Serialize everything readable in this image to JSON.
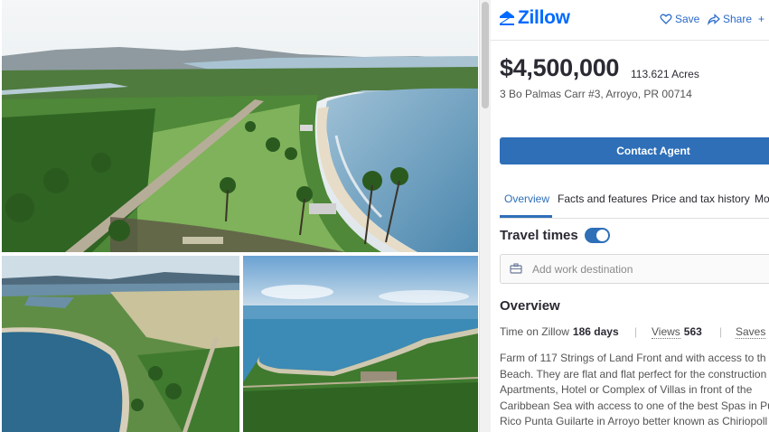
{
  "gallery": {
    "main_photo": "aerial-coastline-palm-estate",
    "bottom_left_photo": "aerial-bay-and-town",
    "bottom_right_photo": "aerial-ocean-shoreline"
  },
  "header": {
    "logo_text": "Zillow",
    "logo_icon": "zillow-z-house-icon",
    "save_label": "Save",
    "share_label": "Share",
    "more_glyph": "+"
  },
  "listing": {
    "price": "$4,500,000",
    "acres": "113.621 Acres",
    "address": "3 Bo Palmas Carr #3, Arroyo, PR 00714"
  },
  "contact_button": "Contact Agent",
  "tabs": [
    {
      "label": "Overview",
      "active": true
    },
    {
      "label": "Facts and features",
      "active": false
    },
    {
      "label": "Price and tax history",
      "active": false
    },
    {
      "label": "Mo",
      "active": false
    }
  ],
  "travel": {
    "label": "Travel times",
    "toggle_on": true,
    "placeholder": "Add work destination"
  },
  "overview": {
    "title": "Overview",
    "time_label": "Time on Zillow",
    "time_value": "186 days",
    "views_label": "Views",
    "views_value": "563",
    "saves_label": "Saves",
    "description_lines": [
      "Farm of 117 Strings of Land Front and with access to th",
      "Beach. They are flat and flat perfect for the construction",
      "Apartments, Hotel or Complex of Villas in front of the",
      "Caribbean Sea with access to one of the best Spas in Pu",
      "Rico Punta Guilarte in Arroyo better known as Chiriopoll"
    ]
  },
  "colors": {
    "brand": "#006aff",
    "button": "#2e6fb8",
    "text": "#2a2a33"
  }
}
